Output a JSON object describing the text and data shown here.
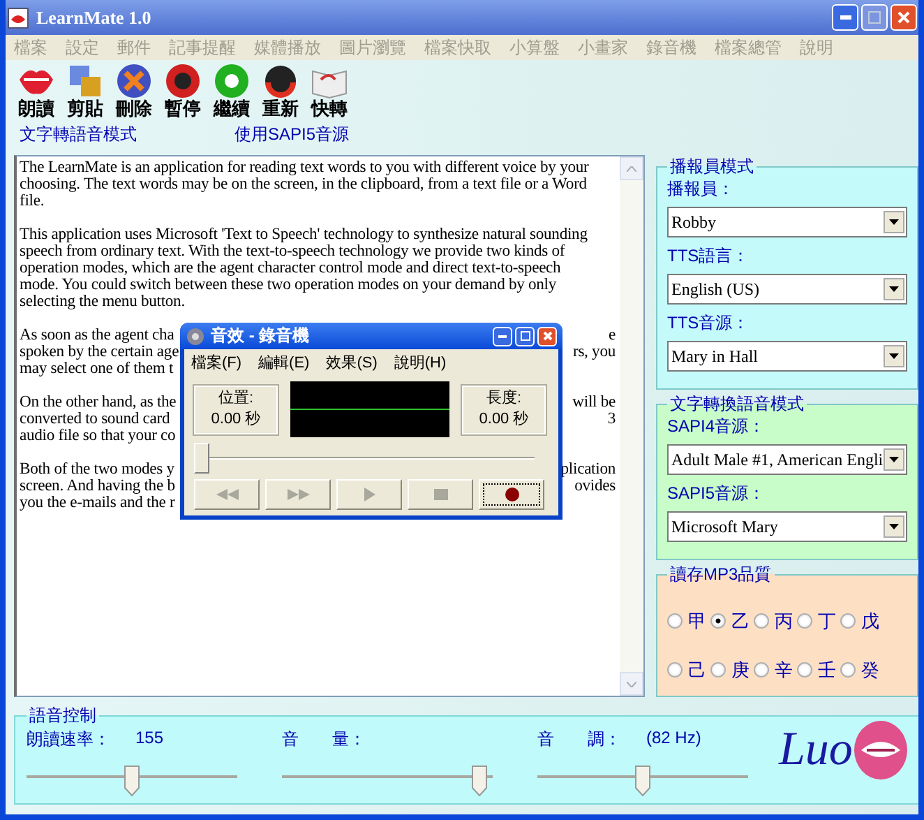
{
  "window": {
    "title": "LearnMate 1.0"
  },
  "menu": [
    {
      "label": "檔案",
      "disabled": true
    },
    {
      "label": "設定",
      "disabled": true
    },
    {
      "label": "郵件",
      "disabled": true
    },
    {
      "label": "記事提醒",
      "disabled": true
    },
    {
      "label": "媒體播放",
      "disabled": true
    },
    {
      "label": "圖片瀏覽",
      "disabled": true
    },
    {
      "label": "檔案快取",
      "disabled": true
    },
    {
      "label": "小算盤",
      "disabled": true
    },
    {
      "label": "小畫家",
      "disabled": true
    },
    {
      "label": "錄音機",
      "disabled": true
    },
    {
      "label": "檔案總管",
      "disabled": true
    },
    {
      "label": "說明",
      "disabled": true
    }
  ],
  "toolbar": [
    {
      "label": "朗讀",
      "kind": "lips"
    },
    {
      "label": "剪貼",
      "kind": "clipboard"
    },
    {
      "label": "刪除",
      "kind": "delete"
    },
    {
      "label": "暫停",
      "kind": "pause"
    },
    {
      "label": "繼續",
      "kind": "resume"
    },
    {
      "label": "重新",
      "kind": "restart"
    },
    {
      "label": "快轉",
      "kind": "book"
    }
  ],
  "mode_bar": [
    "文字轉語音模式",
    "使用SAPI5音源"
  ],
  "editor": {
    "paragraphs": [
      {
        "lines": [
          {
            "text": "The LearnMate is an application for reading text words to you with different voice by your"
          },
          {
            "text": "choosing. The text words may be on the screen, in the clipboard, from a text file or a Word"
          },
          {
            "text": "file."
          }
        ]
      },
      {
        "lines": [
          {
            "text": "This application uses Microsoft 'Text to Speech' technology to synthesize natural sounding"
          },
          {
            "text": "speech from ordinary text. With the text-to-speech technology we provide two kinds of"
          },
          {
            "text": "operation modes, which are the agent character control mode and direct text-to-speech"
          },
          {
            "text": "mode. You could switch between these two operation modes on your demand by only"
          },
          {
            "text": "selecting the menu button."
          }
        ]
      },
      {
        "lines": [
          {
            "text": "As soon as the agent cha",
            "tail": "e"
          },
          {
            "text": "spoken by the certain age",
            "tail": "rs, you"
          },
          {
            "text": "may select one of them t"
          }
        ]
      },
      {
        "lines": [
          {
            "text": "On the other hand, as the",
            "tail": "will be"
          },
          {
            "text": "converted to sound card",
            "tail": "3"
          },
          {
            "text": "audio file so that your co"
          }
        ]
      },
      {
        "lines": [
          {
            "text": "Both of the two modes y",
            "tail": "plication"
          },
          {
            "text": "screen. And having the b",
            "tail": "ovides"
          },
          {
            "text": "you the e-mails and the r"
          }
        ]
      }
    ]
  },
  "recorder": {
    "title": "音效 - 錄音機",
    "menu": [
      "檔案(F)",
      "編輯(E)",
      "效果(S)",
      "說明(H)"
    ],
    "position_label": "位置:",
    "position": "0.00 秒",
    "length_label": "長度:",
    "length": "0.00 秒",
    "seek": {
      "level": 0
    },
    "buttons": [
      {
        "kind": "rewind",
        "disabled": true
      },
      {
        "kind": "forward",
        "disabled": true
      },
      {
        "kind": "play",
        "disabled": true
      },
      {
        "kind": "stop",
        "disabled": true
      },
      {
        "kind": "record",
        "disabled": false
      }
    ]
  },
  "panels": [
    {
      "kind": "fields",
      "title": "播報員模式",
      "color": "#c4fafa",
      "fields": [
        {
          "label": "播報員：",
          "value": "Robby"
        },
        {
          "label": "TTS語言：",
          "value": "English (US)"
        },
        {
          "label": "TTS音源：",
          "value": "Mary in Hall"
        }
      ]
    },
    {
      "kind": "fields",
      "title": "文字轉換語音模式",
      "color": "#c8fcc8",
      "fields": [
        {
          "label": "SAPI4音源：",
          "value": "Adult Male #1, American Engli"
        },
        {
          "label": "SAPI5音源：",
          "value": "Microsoft Mary"
        }
      ]
    },
    {
      "kind": "radios",
      "title": "讀存MP3品質",
      "color": "#fde0c4",
      "options": [
        {
          "label": "甲",
          "selected": false
        },
        {
          "label": "乙",
          "selected": true
        },
        {
          "label": "丙",
          "selected": false
        },
        {
          "label": "丁",
          "selected": false
        },
        {
          "label": "戊",
          "selected": false
        },
        {
          "label": "己",
          "selected": false
        },
        {
          "label": "庚",
          "selected": false
        },
        {
          "label": "辛",
          "selected": false
        },
        {
          "label": "壬",
          "selected": false
        },
        {
          "label": "癸",
          "selected": false
        }
      ]
    }
  ],
  "voice_control": {
    "title": "語音控制",
    "controls": [
      {
        "label": "朗讀速率：",
        "reading": "155",
        "level": 0.5
      },
      {
        "label": "音　　量：",
        "level": 0.97
      },
      {
        "label": "音　　調：",
        "reading": "(82 Hz)",
        "level": 0.5
      }
    ],
    "logo": "Luo"
  }
}
